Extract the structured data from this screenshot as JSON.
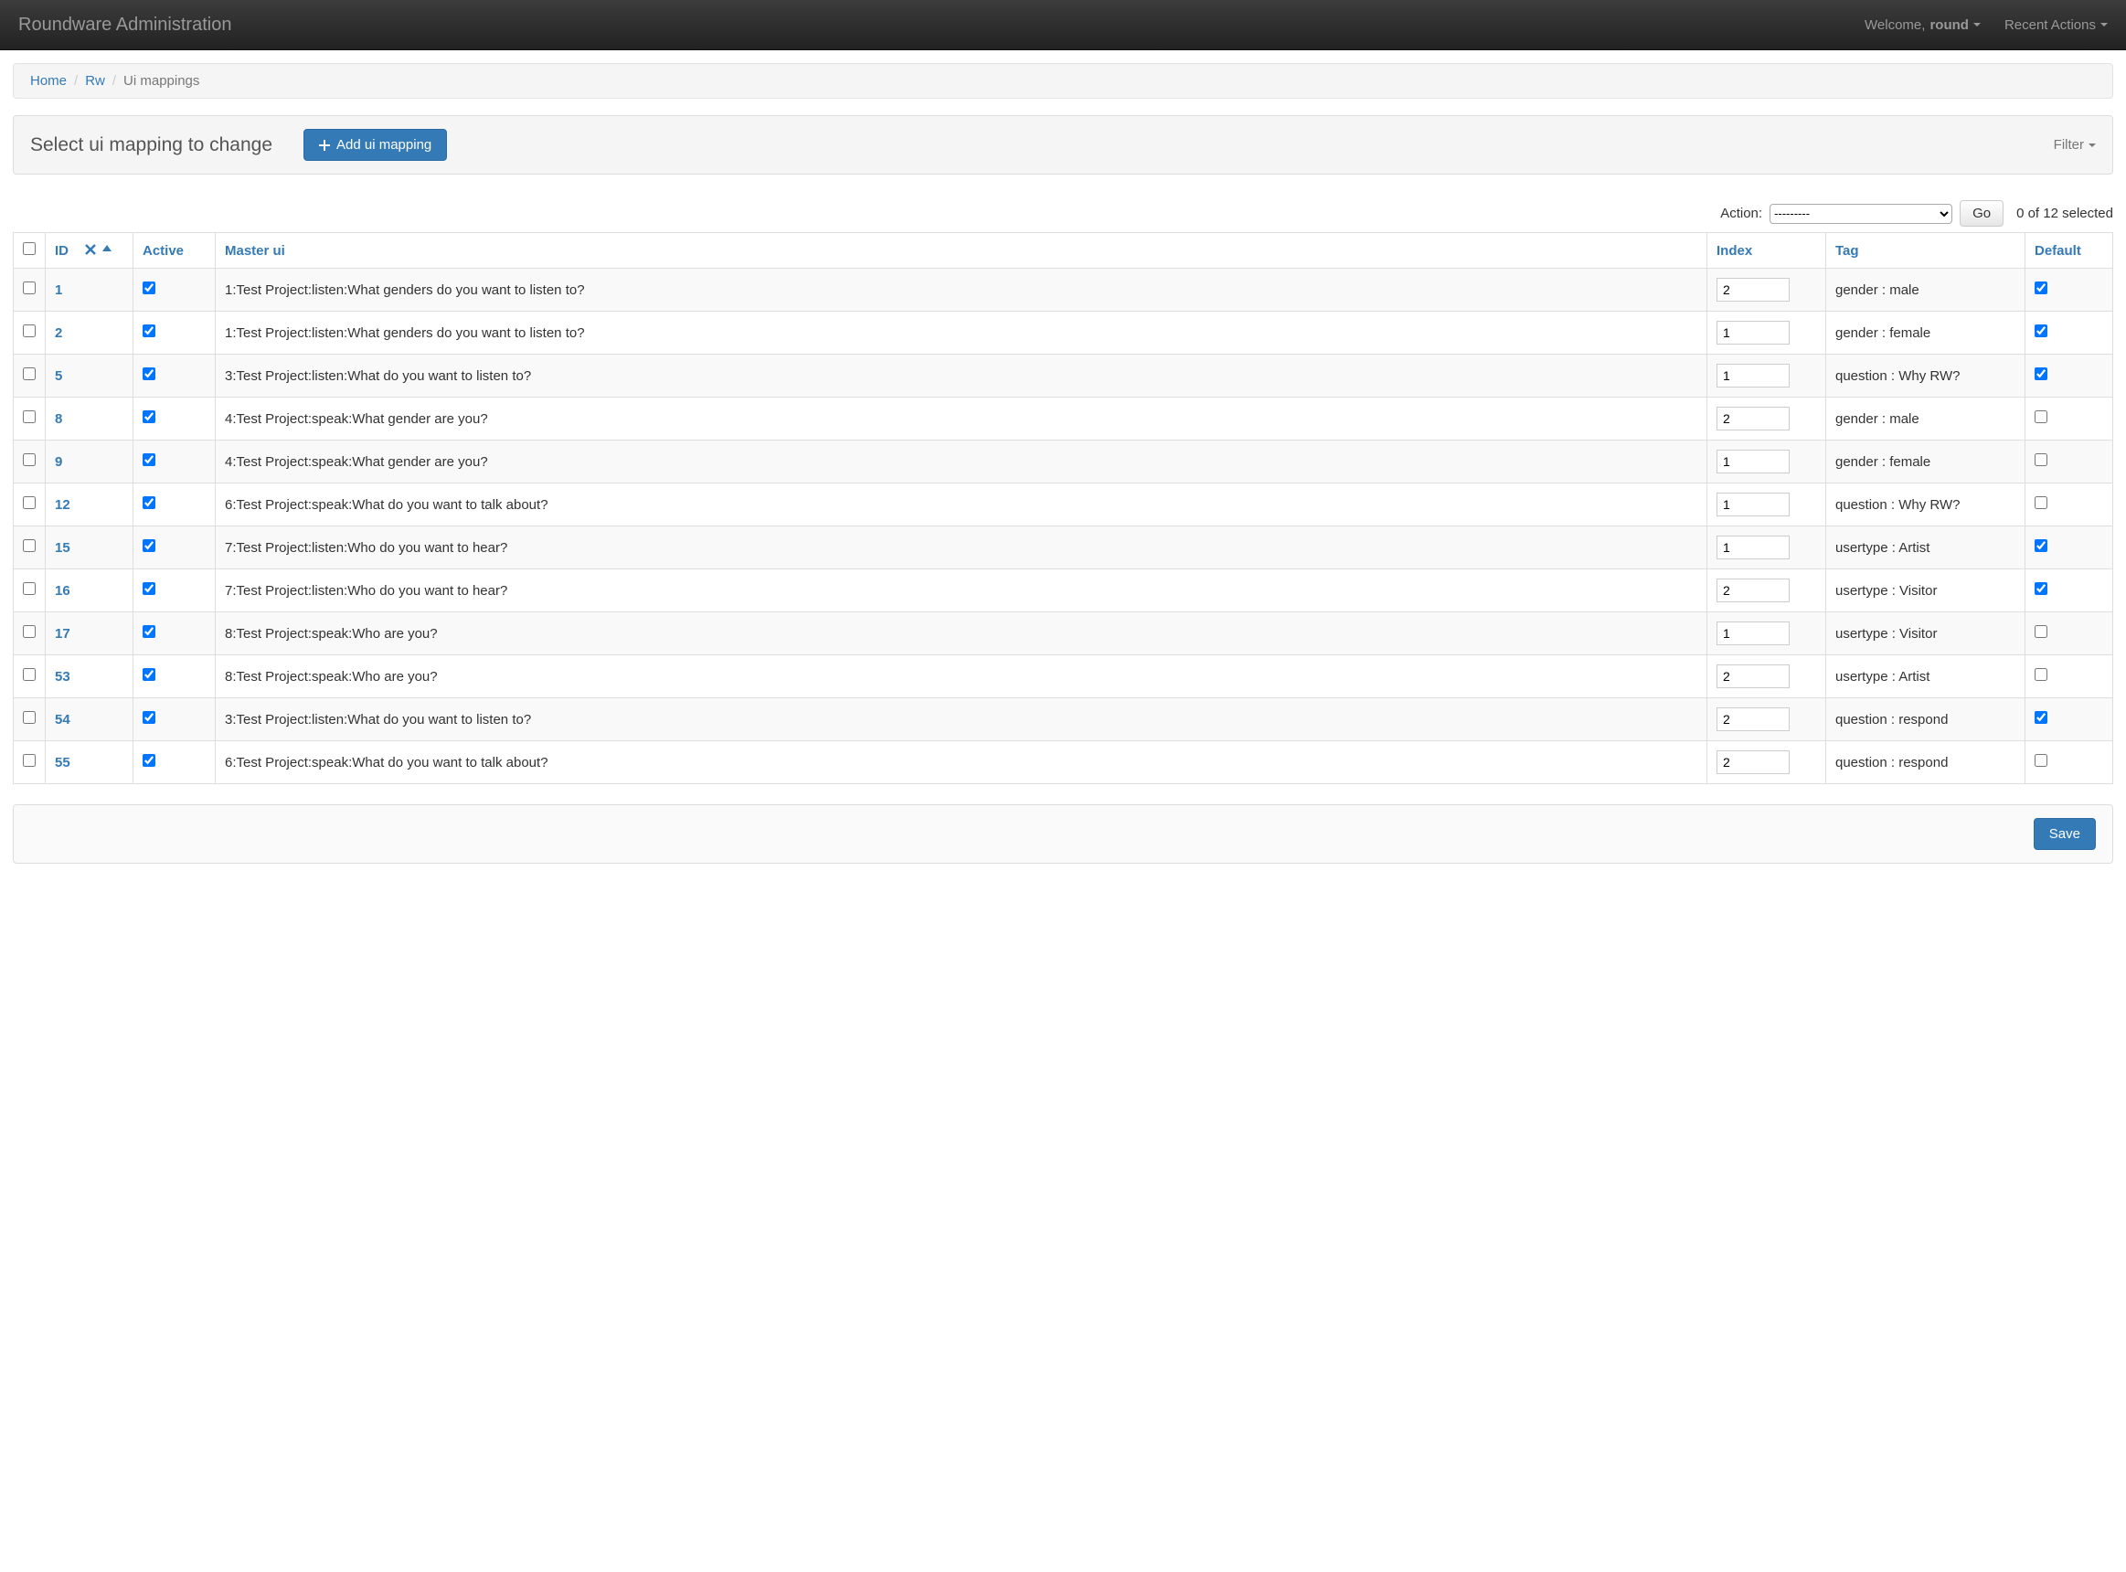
{
  "navbar": {
    "brand": "Roundware Administration",
    "welcome_prefix": "Welcome, ",
    "username": "round",
    "recent_actions": "Recent Actions"
  },
  "breadcrumb": {
    "home": "Home",
    "app": "Rw",
    "current": "Ui mappings"
  },
  "header": {
    "title": "Select ui mapping to change",
    "add_label": "Add ui mapping",
    "filter_label": "Filter"
  },
  "actions": {
    "label": "Action:",
    "placeholder": "---------",
    "go_label": "Go",
    "selection_text": "0 of 12 selected"
  },
  "columns": {
    "id": "ID",
    "active": "Active",
    "master_ui": "Master ui",
    "index": "Index",
    "tag": "Tag",
    "default": "Default"
  },
  "rows": [
    {
      "id": "1",
      "active": true,
      "master_ui": "1:Test Project:listen:What genders do you want to listen to?",
      "index": "2",
      "tag": "gender : male",
      "default": true
    },
    {
      "id": "2",
      "active": true,
      "master_ui": "1:Test Project:listen:What genders do you want to listen to?",
      "index": "1",
      "tag": "gender : female",
      "default": true
    },
    {
      "id": "5",
      "active": true,
      "master_ui": "3:Test Project:listen:What do you want to listen to?",
      "index": "1",
      "tag": "question : Why RW?",
      "default": true
    },
    {
      "id": "8",
      "active": true,
      "master_ui": "4:Test Project:speak:What gender are you?",
      "index": "2",
      "tag": "gender : male",
      "default": false
    },
    {
      "id": "9",
      "active": true,
      "master_ui": "4:Test Project:speak:What gender are you?",
      "index": "1",
      "tag": "gender : female",
      "default": false
    },
    {
      "id": "12",
      "active": true,
      "master_ui": "6:Test Project:speak:What do you want to talk about?",
      "index": "1",
      "tag": "question : Why RW?",
      "default": false
    },
    {
      "id": "15",
      "active": true,
      "master_ui": "7:Test Project:listen:Who do you want to hear?",
      "index": "1",
      "tag": "usertype : Artist",
      "default": true
    },
    {
      "id": "16",
      "active": true,
      "master_ui": "7:Test Project:listen:Who do you want to hear?",
      "index": "2",
      "tag": "usertype : Visitor",
      "default": true
    },
    {
      "id": "17",
      "active": true,
      "master_ui": "8:Test Project:speak:Who are you?",
      "index": "1",
      "tag": "usertype : Visitor",
      "default": false
    },
    {
      "id": "53",
      "active": true,
      "master_ui": "8:Test Project:speak:Who are you?",
      "index": "2",
      "tag": "usertype : Artist",
      "default": false
    },
    {
      "id": "54",
      "active": true,
      "master_ui": "3:Test Project:listen:What do you want to listen to?",
      "index": "2",
      "tag": "question : respond",
      "default": true
    },
    {
      "id": "55",
      "active": true,
      "master_ui": "6:Test Project:speak:What do you want to talk about?",
      "index": "2",
      "tag": "question : respond",
      "default": false
    }
  ],
  "footer": {
    "save_label": "Save"
  }
}
